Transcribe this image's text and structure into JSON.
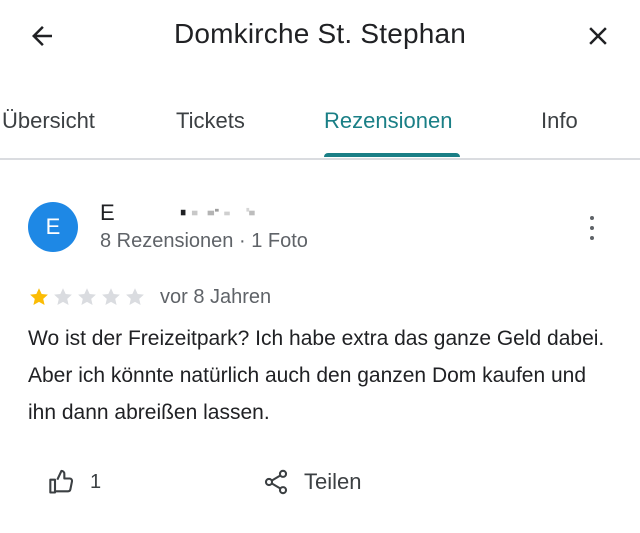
{
  "header": {
    "title": "Domkirche St. Stephan",
    "back_icon": "arrow-back-icon",
    "close_icon": "close-icon"
  },
  "tabs": [
    {
      "label": "Übersicht",
      "active": false
    },
    {
      "label": "Tickets",
      "active": false
    },
    {
      "label": "Rezensionen",
      "active": true
    },
    {
      "label": "Info",
      "active": false
    }
  ],
  "review": {
    "avatar_letter": "E",
    "author_name": "E",
    "author_meta": "8 Rezensionen · 1 Foto",
    "rating": 1,
    "max_rating": 5,
    "date": "vor 8 Jahren",
    "text": "Wo ist der Freizeitpark? Ich habe extra das ganze Geld dabei. Aber ich könnte natürlich auch den ganzen Dom kaufen und ihn dann abreißen lassen.",
    "like_count": "1",
    "share_label": "Teilen"
  },
  "colors": {
    "accent": "#1a7f86",
    "avatar": "#1e88e5",
    "star_filled": "#fbbc04",
    "star_empty": "#dadce0"
  }
}
